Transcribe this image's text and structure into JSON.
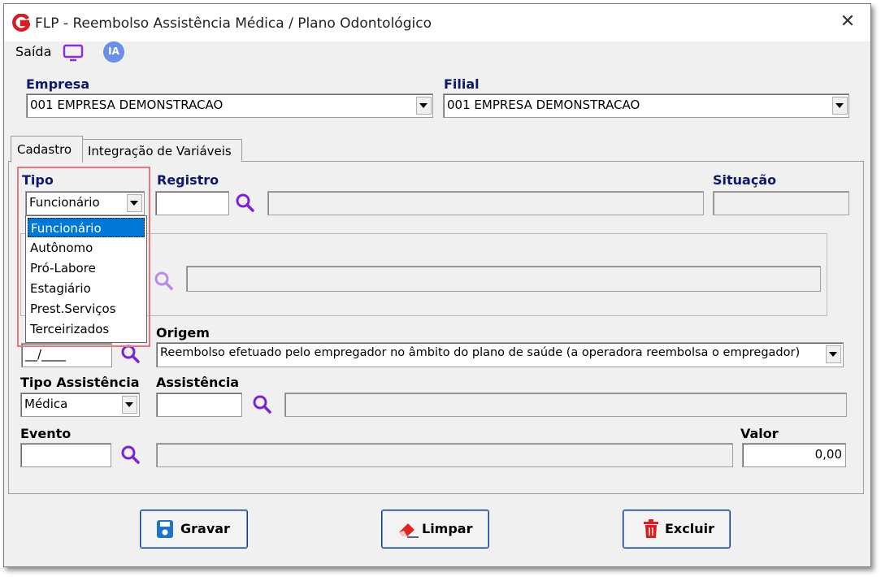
{
  "window": {
    "title": "FLP - Reembolso Assistência Médica / Plano Odontológico",
    "close_glyph": "✕"
  },
  "menu": {
    "saida_label": "Saída",
    "ia_label": "IA"
  },
  "empresa": {
    "label": "Empresa",
    "value": "001 EMPRESA DEMONSTRACAO"
  },
  "filial": {
    "label": "Filial",
    "value": "001 EMPRESA DEMONSTRACAO"
  },
  "tabs": [
    {
      "label": "Cadastro",
      "active": true
    },
    {
      "label": "Integração de Variáveis",
      "active": false
    }
  ],
  "tipo": {
    "label": "Tipo",
    "value": "Funcionário",
    "options": [
      "Funcionário",
      "Autônomo",
      "Pró-Labore",
      "Estagiário",
      "Prest.Serviços",
      "Terceirizados"
    ],
    "selected_index": 0
  },
  "registro": {
    "label": "Registro",
    "value": "",
    "description": ""
  },
  "situacao": {
    "label": "Situação",
    "value": ""
  },
  "competencia": {
    "value": "__/____"
  },
  "origem": {
    "label": "Origem",
    "value": "Reembolso efetuado pelo empregador no âmbito do plano de saúde (a operadora reembolsa o empregador)"
  },
  "tipo_assistencia": {
    "label": "Tipo Assistência",
    "value": "Médica"
  },
  "assistencia": {
    "label": "Assistência",
    "value": "",
    "description": ""
  },
  "evento": {
    "label": "Evento",
    "value": "",
    "description": ""
  },
  "valor": {
    "label": "Valor",
    "value": "0,00"
  },
  "buttons": {
    "gravar": "Gravar",
    "limpar": "Limpar",
    "excluir": "Excluir"
  },
  "colors": {
    "brand": "#d32027",
    "label_navy": "#0d1a6b",
    "selection": "#0078d7",
    "highlight_box": "#e8767c",
    "icon_purple": "#8a2be2"
  }
}
